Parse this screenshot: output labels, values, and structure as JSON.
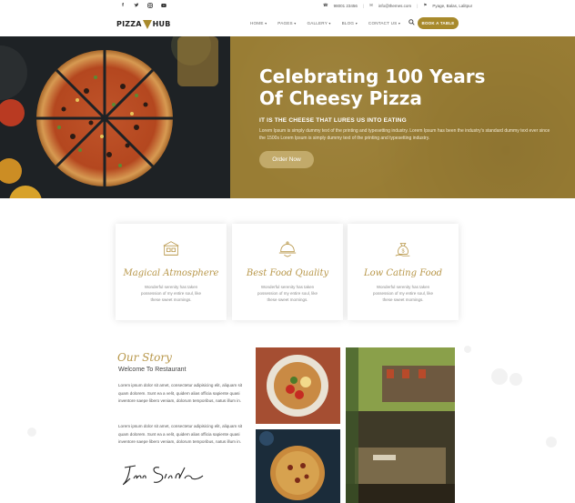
{
  "topbar": {
    "social_icons": [
      "facebook-icon",
      "twitter-icon",
      "instagram-icon",
      "youtube-icon"
    ],
    "phone": "98001 23456",
    "email": "info@themes.com",
    "address": "Pyage, Balas, Lalitpur"
  },
  "header": {
    "logo_left": "PIZZA",
    "logo_right": "HUB",
    "nav": [
      "HOME",
      "PAGES",
      "GALLERY",
      "BLOG",
      "CONTACT US"
    ],
    "book_button": "BOOK A TABLE"
  },
  "hero": {
    "title_line1": "Celebrating 100 Years",
    "title_line2": "Of Cheesy Pizza",
    "subtitle": "IT IS THE CHEESE THAT LURES US INTO EATING",
    "body": "Lorem Ipsum is simply dummy text of the printing and typesetting industry. Lorem Ipsum has been the industry's standard dummy text ever since the 1500s Lorem Ipsum is simply dummy text of the printing and typesetting industry.",
    "button": "Order Now"
  },
  "features": [
    {
      "title": "Magical Atmosphere",
      "icon": "restaurant-icon",
      "desc": "Wonderful serenity has taken possession of my entire soul, like these sweet mornings."
    },
    {
      "title": "Best Food Quality",
      "icon": "cloche-icon",
      "desc": "Wonderful serenity has taken possession of my entire soul, like these sweet mornings."
    },
    {
      "title": "Low Cating Food",
      "icon": "money-bag-icon",
      "desc": "Wonderful serenity has taken possession of my entire soul, like these sweet mornings."
    }
  ],
  "story": {
    "title": "Our Story",
    "subtitle": "Welcome To Restaurant",
    "para1": "Lorem ipsum dolor sit amet, consectetur adipisicing elit, aliquam sit quam dolorem. Sunt ea a velit, quidem alias officia sapiente quasi inventore saepe libero veniam, dolorum temporibus, natus illum in.",
    "para2": "Lorem ipsum dolor sit amet, consectetur adipisicing elit, aliquam sit quam dolorem. Sunt ea a velit, quidem alias officia sapiente quasi inventore saepe libero veniam, dolorum temporibus, natus illum in.",
    "signature": "Frank Sinatra"
  },
  "colors": {
    "accent": "#a88a2c",
    "hero_panel": "#997d34",
    "feature_title": "#b8974a"
  }
}
